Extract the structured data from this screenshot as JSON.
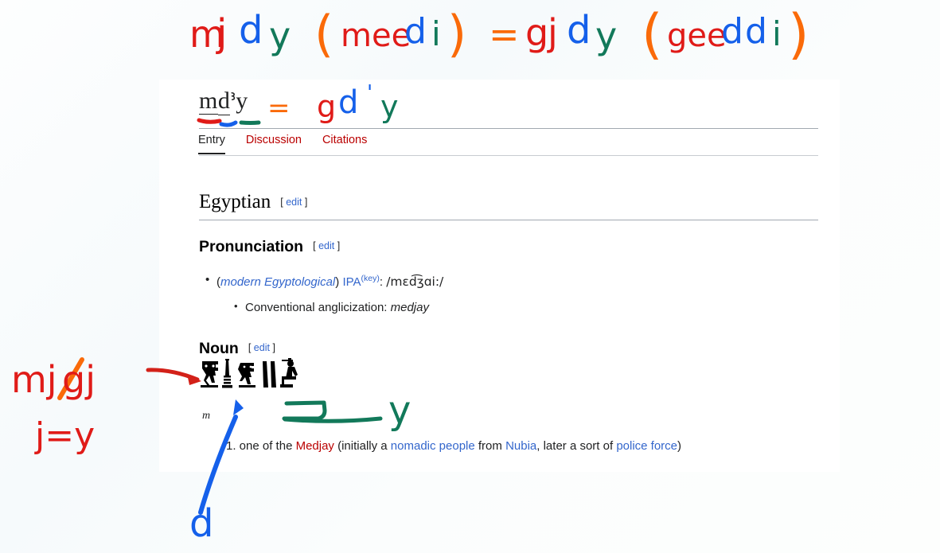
{
  "window": {
    "background_color": "#fbfdfd",
    "content_panel_color": "#ffffff"
  },
  "colors": {
    "link_blue": "#3366cc",
    "link_red": "#ba0000",
    "text": "#202122",
    "rule": "#a2a9b1",
    "ink_red": "#e01b18",
    "ink_blue": "#1560ea",
    "ink_green": "#12795a",
    "ink_orange": "#fa6a09"
  },
  "page": {
    "title_m": "m",
    "title_d": "d",
    "title_alef": "ꜣ",
    "title_y": "y",
    "title_full": "mḏꜣy"
  },
  "tabs": [
    {
      "label": "Entry",
      "active": true
    },
    {
      "label": "Discussion",
      "active": false
    },
    {
      "label": "Citations",
      "active": false
    }
  ],
  "sections": {
    "language": {
      "heading": "Egyptian",
      "edit_open": "[",
      "edit_label": "edit",
      "edit_close": "]"
    },
    "pronunciation": {
      "heading": "Pronunciation",
      "edit_open": "[",
      "edit_label": "edit",
      "edit_close": "]",
      "line1_open_paren": "(",
      "line1_register": "modern Egyptological",
      "line1_close_paren": ")",
      "line1_ipa_label": "IPA",
      "line1_key": "(key)",
      "line1_colon": ": ",
      "line1_ipa_value": "/mɛd͡ʒɑi:/",
      "line2_label": "Conventional anglicization: ",
      "line2_value": "medjay"
    },
    "noun": {
      "heading": "Noun",
      "edit_open": "[",
      "edit_label": "edit",
      "edit_close": "]",
      "hieroglyphs": "𓅓𓊽𓄿𓏭𓀀",
      "glyph_caption": "m",
      "definition_number": "1.",
      "def_part1": " one of the ",
      "def_medjay": "Medjay",
      "def_part2": " (initially a ",
      "def_nomadic": "nomadic people",
      "def_part3": " from ",
      "def_nubia": "Nubia",
      "def_part4": ", later a sort of ",
      "def_police": "police force",
      "def_part5": ")"
    }
  },
  "annotations": {
    "top_banner": {
      "m": "m",
      "j1": "j",
      "d1": "d",
      "y1": "y",
      "paren_open1": "(",
      "mee": "mee",
      "d2": "d",
      "i1": "i",
      "paren_close1": ")",
      "equals": "=",
      "g": "g",
      "j2": "j",
      "d3": "d",
      "y2": "y",
      "paren_open2": "(",
      "gee": "gee",
      "d4": "d",
      "d5": "d",
      "i2": "i",
      "paren_close2": ")"
    },
    "title_overlay": {
      "m": "m",
      "d": "d",
      "alef": "ꜣ",
      "y": "y",
      "equals": "=",
      "g": "g",
      "d2": "d",
      "apostrophe": "'",
      "y2": "y"
    },
    "left_notes": {
      "line1_a": "mj",
      "line1_slash": "/",
      "line1_b": "gj",
      "line2": "j=y"
    },
    "glyph_notes": {
      "d_label": "d",
      "y_label": "y"
    }
  }
}
